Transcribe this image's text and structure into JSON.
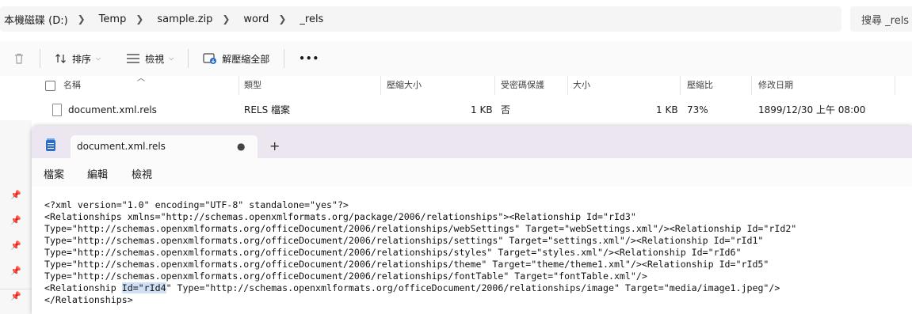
{
  "explorer": {
    "breadcrumb": [
      "本機磁碟 (D:)",
      "Temp",
      "sample.zip",
      "word",
      "_rels"
    ],
    "search_placeholder": "搜尋 _rels",
    "toolbar": {
      "sort_label": "排序",
      "view_label": "檢視",
      "extract_label": "解壓縮全部",
      "more_label": "•••"
    },
    "columns": [
      "名稱",
      "類型",
      "壓縮大小",
      "受密碼保護",
      "大小",
      "壓縮比",
      "修改日期"
    ],
    "files": [
      {
        "name": "document.xml.rels",
        "type": "RELS 檔案",
        "compressed_size": "1 KB",
        "password": "否",
        "size": "1 KB",
        "ratio": "73%",
        "modified": "1899/12/30 上午 08:00"
      }
    ]
  },
  "notepad": {
    "tab_title": "document.xml.rels",
    "tab_dot": "●",
    "new_tab": "+",
    "menu": [
      "檔案",
      "編輯",
      "檢視"
    ],
    "lines": [
      "<?xml version=\"1.0\" encoding=\"UTF-8\" standalone=\"yes\"?>",
      "<Relationships xmlns=\"http://schemas.openxmlformats.org/package/2006/relationships\"><Relationship Id=\"rId3\"",
      "Type=\"http://schemas.openxmlformats.org/officeDocument/2006/relationships/webSettings\" Target=\"webSettings.xml\"/><Relationship Id=\"rId2\"",
      "Type=\"http://schemas.openxmlformats.org/officeDocument/2006/relationships/settings\" Target=\"settings.xml\"/><Relationship Id=\"rId1\"",
      "Type=\"http://schemas.openxmlformats.org/officeDocument/2006/relationships/styles\" Target=\"styles.xml\"/><Relationship Id=\"rId6\"",
      "Type=\"http://schemas.openxmlformats.org/officeDocument/2006/relationships/theme\" Target=\"theme/theme1.xml\"/><Relationship Id=\"rId5\"",
      "Type=\"http://schemas.openxmlformats.org/officeDocument/2006/relationships/fontTable\" Target=\"fontTable.xml\"/>"
    ],
    "line7": {
      "before": "<Relationship ",
      "selected": "Id=\"rId4",
      "after": "\" Type=\"http://schemas.openxmlformats.org/officeDocument/2006/relationships/image\" Target=\"media/image1.jpeg\"/>"
    },
    "last_line": "</Relationships>"
  },
  "colors": {
    "titlebar": "#ece6f0",
    "selection": "#cfe0f5",
    "accent": "#2b6ec6"
  }
}
